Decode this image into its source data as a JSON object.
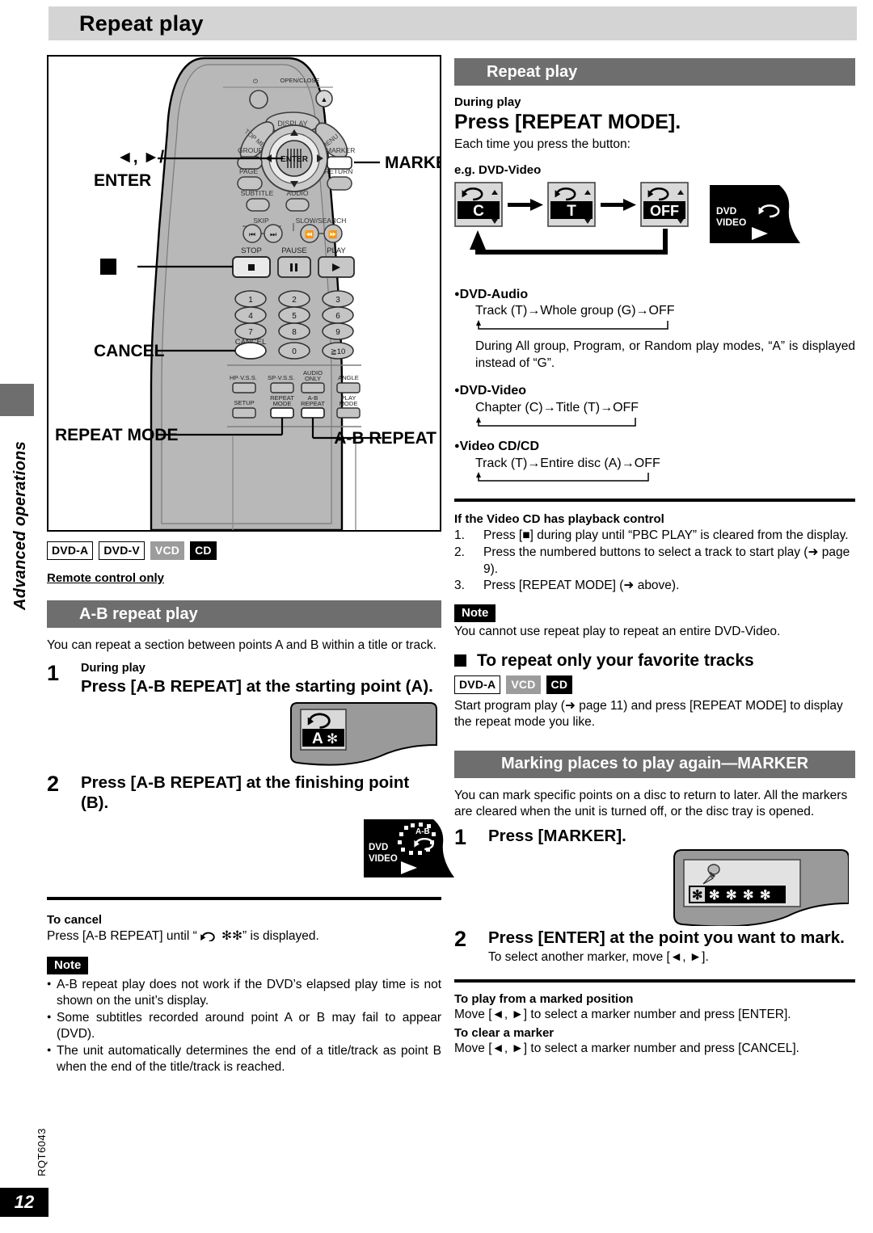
{
  "page": {
    "title": "Repeat play",
    "side_label": "Advanced operations",
    "doc_code": "RQT6043",
    "page_number": "12",
    "colors": {
      "header_bar": "#6e6e6e",
      "title_bar": "#d4d4d4",
      "badge_gray": "#9c9c9c"
    }
  },
  "remote": {
    "callouts": {
      "left_enter_1": "◄, ►/",
      "left_enter_2": "ENTER",
      "left_stop": "■",
      "left_cancel": "CANCEL",
      "left_repeat_mode": "REPEAT MODE",
      "right_marker": "MARKER",
      "right_ab_repeat": "A-B REPEAT"
    },
    "buttons": {
      "power": "⏻",
      "open_close": "OPEN/CLOSE",
      "display": "DISPLAY",
      "top_menu": "TOP MENU",
      "menu": "MENU",
      "enter": "ENTER",
      "group": "GROUP",
      "marker": "MARKER",
      "page": "PAGE",
      "return": "RETURN",
      "subtitle": "SUBTITLE",
      "audio": "AUDIO",
      "skip": "SKIP",
      "slow_search": "SLOW/SEARCH",
      "stop": "STOP",
      "pause": "PAUSE",
      "play": "PLAY",
      "cancel": "CANCEL",
      "numbers": [
        "1",
        "2",
        "3",
        "4",
        "5",
        "6",
        "7",
        "8",
        "9",
        "0",
        "≧10"
      ],
      "hp_vss": "HP·V.S.S.",
      "sp_vss": "SP·V.S.S.",
      "audio_only_1": "AUDIO",
      "audio_only_2": "ONLY",
      "angle": "ANGLE",
      "setup": "SETUP",
      "repeat_mode_1": "REPEAT",
      "repeat_mode_2": "MODE",
      "ab_repeat_1": "A-B",
      "ab_repeat_2": "REPEAT",
      "play_mode_1": "PLAY",
      "play_mode_2": "MODE"
    }
  },
  "left": {
    "badges": [
      {
        "label": "DVD-A",
        "style": "white"
      },
      {
        "label": "DVD-V",
        "style": "white"
      },
      {
        "label": "VCD",
        "style": "gray"
      },
      {
        "label": "CD",
        "style": "black"
      }
    ],
    "remote_only": "Remote control only",
    "section_title": "A-B repeat play",
    "intro": "You can repeat a section between points A and B within a title or track.",
    "step1": {
      "num": "1",
      "pre": "During play",
      "main": "Press [A-B REPEAT] at the starting point (A)."
    },
    "osd_a": {
      "icon": "repeat-icon",
      "text": "A ✻"
    },
    "step2": {
      "num": "2",
      "main": "Press [A-B REPEAT] at the finishing point (B)."
    },
    "display_ab": {
      "line1": "DVD",
      "line2": "VIDEO",
      "tag": "A-B"
    },
    "to_cancel_head": "To cancel",
    "to_cancel_text_pre": "Press [A-B REPEAT] until “",
    "to_cancel_text_post": "✻✻” is displayed.",
    "note_tag": "Note",
    "notes": [
      "A-B repeat play does not work if the DVD’s elapsed play time is not shown on the unit’s display.",
      "Some subtitles recorded around point A or B may fail to appear (DVD).",
      "The unit automatically determines the end of a title/track as point B when the end of the title/track is reached."
    ]
  },
  "right": {
    "section_title": "Repeat play",
    "during_play": "During play",
    "press_repeat_mode": "Press [REPEAT MODE].",
    "each_time": "Each time you press the button:",
    "eg_label": "e.g. DVD-Video",
    "flow_boxes": [
      "C",
      "T",
      "OFF"
    ],
    "display_dvd": {
      "line1": "DVD",
      "line2": "VIDEO"
    },
    "dvd_audio": {
      "label": "DVD-Audio",
      "flow": "Track (T)→Whole group (G)→OFF",
      "note": "During All group, Program, or Random play modes, “A”  is displayed instead of “G”."
    },
    "dvd_video": {
      "label": "DVD-Video",
      "flow": "Chapter (C)→Title (T)→OFF"
    },
    "video_cd": {
      "label": "Video CD/CD",
      "flow": "Track (T)→Entire disc (A)→OFF"
    },
    "pbc_head": "If the Video CD has playback control",
    "pbc_steps": [
      {
        "n": "1.",
        "text": "Press [■] during play until “PBC PLAY” is cleared from the display."
      },
      {
        "n": "2.",
        "text": "Press the numbered buttons to select a track to start play (➜ page 9)."
      },
      {
        "n": "3.",
        "text": "Press [REPEAT MODE] (➜ above)."
      }
    ],
    "note_tag": "Note",
    "note_text": "You cannot use repeat play to repeat an entire DVD-Video.",
    "fav_head": "To repeat only your favorite tracks",
    "fav_badges": [
      {
        "label": "DVD-A",
        "style": "white"
      },
      {
        "label": "VCD",
        "style": "gray"
      },
      {
        "label": "CD",
        "style": "black"
      }
    ],
    "fav_text": "Start program play (➜ page 11) and press [REPEAT MODE] to display the repeat mode you like.",
    "marker_section_title": "Marking places to play again—MARKER",
    "marker_intro": "You can mark specific points on a disc to return to later. All the markers are cleared when the unit is turned off, or the disc tray is opened.",
    "marker_step1": {
      "num": "1",
      "main": "Press [MARKER]."
    },
    "marker_osd": {
      "icon": "pin-icon",
      "stars": "✻✻✻✻✻"
    },
    "marker_step2": {
      "num": "2",
      "main": "Press [ENTER] at the point you want to mark.",
      "sub": "To select another marker, move [◄, ►]."
    },
    "play_marked_head": "To play from a marked position",
    "play_marked_text": "Move [◄, ►] to select a marker number and press [ENTER].",
    "clear_marker_head": "To clear a marker",
    "clear_marker_text": "Move [◄, ►] to select a marker number and press [CANCEL]."
  }
}
